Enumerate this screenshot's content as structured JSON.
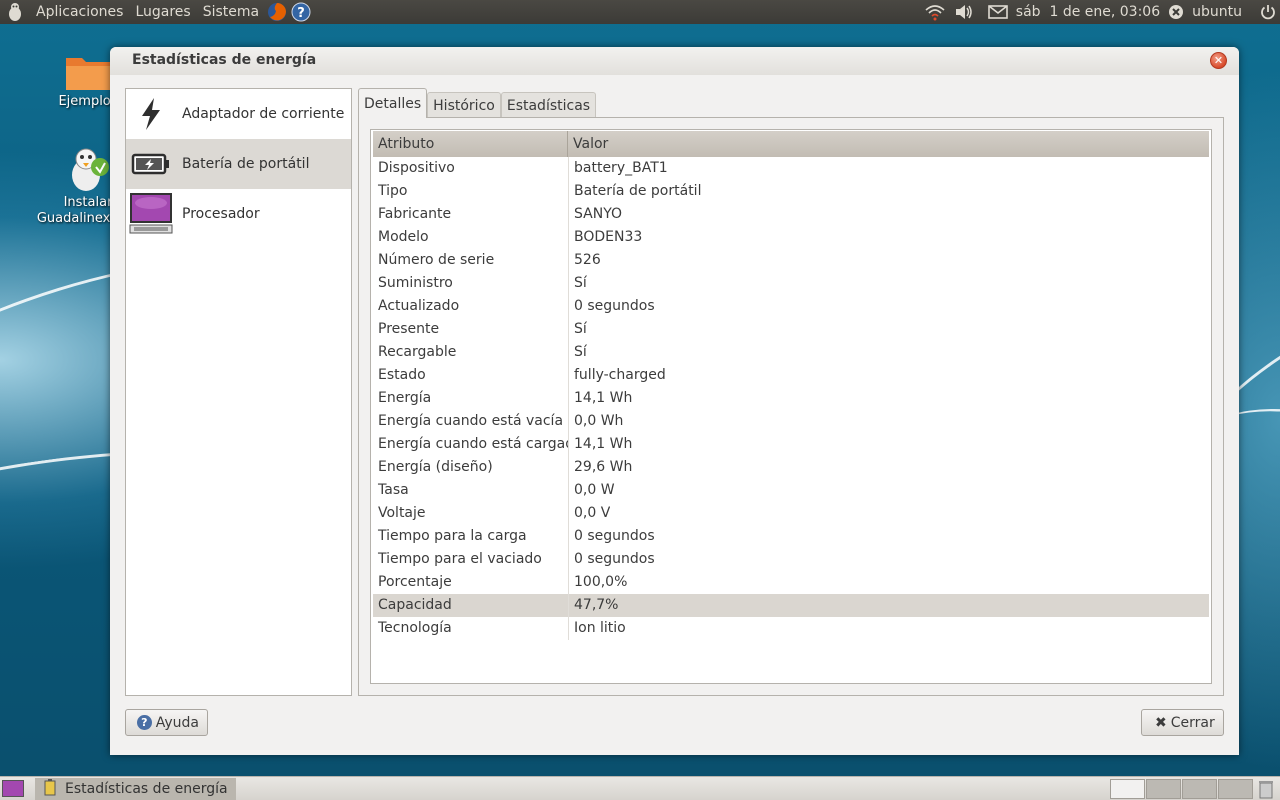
{
  "top_panel": {
    "menus": [
      "Aplicaciones",
      "Lugares",
      "Sistema"
    ],
    "clock": "sáb  1 de ene, 03:06",
    "user": "ubuntu"
  },
  "desktop": {
    "icons": [
      {
        "label": "Ejemplos",
        "icon": "folder-icon"
      },
      {
        "label": "Instalar Guadalinex Edu",
        "icon": "installer-icon"
      }
    ]
  },
  "window": {
    "title": "Estadísticas de energía",
    "devices": [
      {
        "label": "Adaptador de corriente",
        "icon": "lightning-icon"
      },
      {
        "label": "Batería de portátil",
        "icon": "battery-icon",
        "selected": true
      },
      {
        "label": "Procesador",
        "icon": "monitor-icon"
      }
    ],
    "tabs": [
      "Detalles",
      "Histórico",
      "Estadísticas"
    ],
    "active_tab": "Detalles",
    "table": {
      "headers": [
        "Atributo",
        "Valor"
      ],
      "rows": [
        {
          "attr": "Dispositivo",
          "value": "battery_BAT1"
        },
        {
          "attr": "Tipo",
          "value": "Batería de portátil"
        },
        {
          "attr": "Fabricante",
          "value": "SANYO"
        },
        {
          "attr": "Modelo",
          "value": "BODEN33"
        },
        {
          "attr": "Número de serie",
          "value": "526"
        },
        {
          "attr": "Suministro",
          "value": "Sí"
        },
        {
          "attr": "Actualizado",
          "value": "0 segundos"
        },
        {
          "attr": "Presente",
          "value": "Sí"
        },
        {
          "attr": "Recargable",
          "value": "Sí"
        },
        {
          "attr": "Estado",
          "value": "fully-charged"
        },
        {
          "attr": "Energía",
          "value": "14,1 Wh"
        },
        {
          "attr": "Energía cuando está vacía",
          "value": "0,0 Wh"
        },
        {
          "attr": "Energía cuando está cargada",
          "value": "14,1 Wh"
        },
        {
          "attr": "Energía (diseño)",
          "value": "29,6 Wh"
        },
        {
          "attr": "Tasa",
          "value": "0,0 W"
        },
        {
          "attr": "Voltaje",
          "value": "0,0 V"
        },
        {
          "attr": "Tiempo para la carga",
          "value": "0 segundos"
        },
        {
          "attr": "Tiempo para el vaciado",
          "value": "0 segundos"
        },
        {
          "attr": "Porcentaje",
          "value": "100,0%"
        },
        {
          "attr": "Capacidad",
          "value": "47,7%",
          "highlight": true
        },
        {
          "attr": "Tecnología",
          "value": "Ion litio"
        }
      ]
    },
    "help_label": "Ayuda",
    "close_label": "Cerrar"
  },
  "bottom_panel": {
    "task_label": "Estadísticas de energía"
  },
  "colors": {
    "panel_dark": "#3c3b37",
    "window_bg": "#f2f1f0",
    "selection": "#dcd9d4",
    "close_orange": "#d84b2b"
  }
}
